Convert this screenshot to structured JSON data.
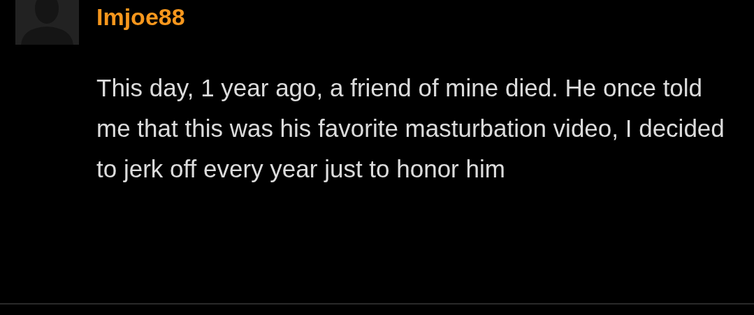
{
  "comment": {
    "username": "Imjoe88",
    "text": "This day, 1 year ago, a friend of mine died. He once told me that this was his favorite masturbation video, I decided to jerk off every year just to honor him"
  }
}
